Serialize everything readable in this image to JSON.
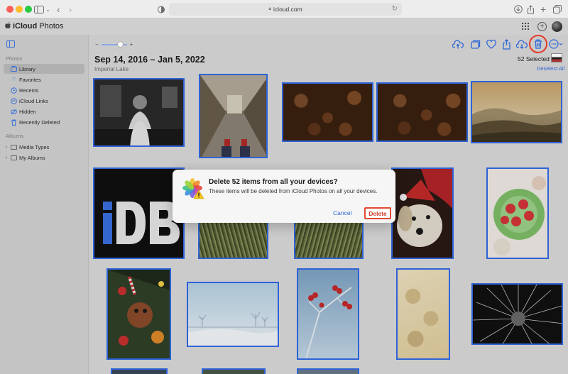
{
  "browser": {
    "url": "icloud.com"
  },
  "app": {
    "title_bold": "iCloud",
    "title_light": " Photos"
  },
  "sidebar": {
    "photos_heading": "Photos",
    "items": [
      {
        "label": "Library",
        "icon": "library-icon"
      },
      {
        "label": "Favorites",
        "icon": "heart-icon"
      },
      {
        "label": "Recents",
        "icon": "clock-icon"
      },
      {
        "label": "iCloud Links",
        "icon": "link-icon"
      },
      {
        "label": "Hidden",
        "icon": "eye-slash-icon"
      },
      {
        "label": "Recently Deleted",
        "icon": "trash-icon"
      }
    ],
    "albums_heading": "Albums",
    "albums": [
      {
        "label": "Media Types"
      },
      {
        "label": "My Albums"
      }
    ]
  },
  "toolbar": {
    "zoom_minus": "−",
    "zoom_plus": "+",
    "selected_count": "52 Selected",
    "deselect_all": "Deselect All"
  },
  "library": {
    "date_range": "Sep 14, 2016 – Jan 5, 2022",
    "location": "Imperial Lake"
  },
  "dialog": {
    "title": "Delete 52 items from all your devices?",
    "message": "These items will be deleted from iCloud Photos on all your devices.",
    "cancel": "Cancel",
    "delete": "Delete"
  },
  "colors": {
    "accent": "#2e66d6",
    "selection_border": "#2f62d6",
    "highlight_red": "#e23b2b"
  }
}
